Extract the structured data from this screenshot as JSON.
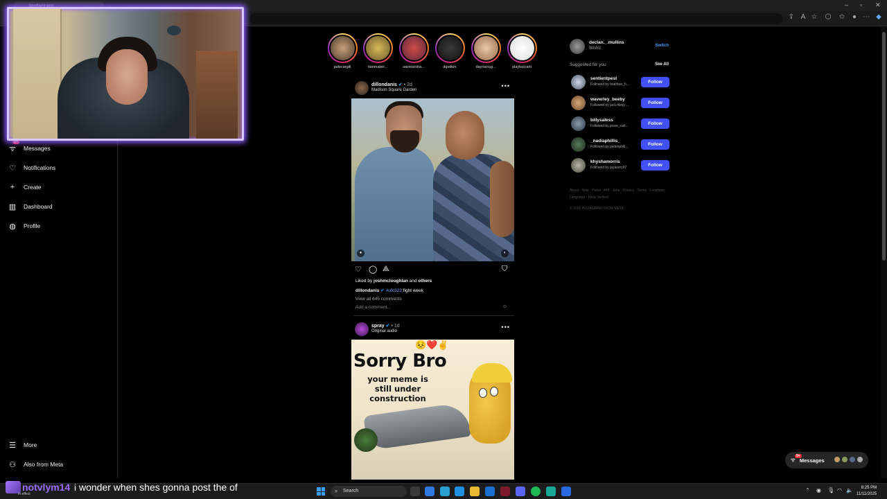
{
  "browser": {
    "tab_title": "Instagram",
    "window_controls": [
      "–",
      "▫",
      "✕"
    ]
  },
  "sidebar": {
    "items": [
      {
        "label": "Messages",
        "icon": "messenger-icon",
        "badge": "9+"
      },
      {
        "label": "Notifications",
        "icon": "heart-icon"
      },
      {
        "label": "Create",
        "icon": "plus-icon"
      },
      {
        "label": "Dashboard",
        "icon": "dashboard-icon"
      },
      {
        "label": "Profile",
        "icon": "profile-icon"
      }
    ],
    "bottom": [
      {
        "label": "More",
        "icon": "menu-icon"
      },
      {
        "label": "Also from Meta",
        "icon": "meta-icon"
      }
    ]
  },
  "stories": [
    {
      "name": "jadecargill"
    },
    {
      "name": "rainmaker..."
    },
    {
      "name": "savmarsha..."
    },
    {
      "name": "dqvdkm"
    },
    {
      "name": "daynanug..."
    },
    {
      "name": "playboicarti"
    }
  ],
  "post1": {
    "username": "dillondanis",
    "time": "• 2d",
    "location": "Madison Square Garden",
    "liked_by_prefix": "Liked by ",
    "liked_by_user": "joshmcloughlan",
    "liked_by_and": " and ",
    "liked_by_others": "others",
    "caption_user": "dillondanis",
    "caption_tag": "#ufc322",
    "caption_text": " fight week",
    "view_comments": "View all 645 comments",
    "add_comment_placeholder": "Add a comment..."
  },
  "post2": {
    "username": "spray",
    "time": "• 1d",
    "audio": "Original audio",
    "meme_emoji": "😣❤️✌️",
    "meme_title": "Sorry Bro",
    "meme_subtitle": "your meme is still under construction"
  },
  "account": {
    "username": "declan._.mullins",
    "name": "Wishlz",
    "switch_label": "Switch"
  },
  "suggested": {
    "header": "Suggested for you",
    "see_all": "See All",
    "follow_label": "Follow",
    "users": [
      {
        "username": "sentientpest",
        "sub": "Followed by braithen_h..."
      },
      {
        "username": "waverley_beeby",
        "sub": "Followed by jack.fitzsy ..."
      },
      {
        "username": "billysaless",
        "sub": "Followed by jesse_catt..."
      },
      {
        "username": "_nadiaphillis_",
        "sub": "Followed by jaidenphill..."
      },
      {
        "username": "khyshamorris",
        "sub": "Followed by jayavery97"
      }
    ]
  },
  "footer": {
    "links": "About · Help · Press · API · Jobs · Privacy · Terms · Locations · Language · Meta Verified",
    "copyright": "© 2025 INSTAGRAM FROM META"
  },
  "floating_messages": {
    "label": "Messages",
    "badge": "9+"
  },
  "chat": {
    "username": "notvlym14",
    "message": "i wonder when shes gonna post the of",
    "small_text": "In effect"
  },
  "taskbar": {
    "search_placeholder": "Search",
    "time": "8:25 PM",
    "date": "11/11/2025"
  },
  "colors": {
    "follow_button": "#4150f7",
    "link_blue": "#4a9eff",
    "badge_red": "#ff3040",
    "webcam_glow": "#8a5cff",
    "chat_name": "#9b6bff"
  }
}
